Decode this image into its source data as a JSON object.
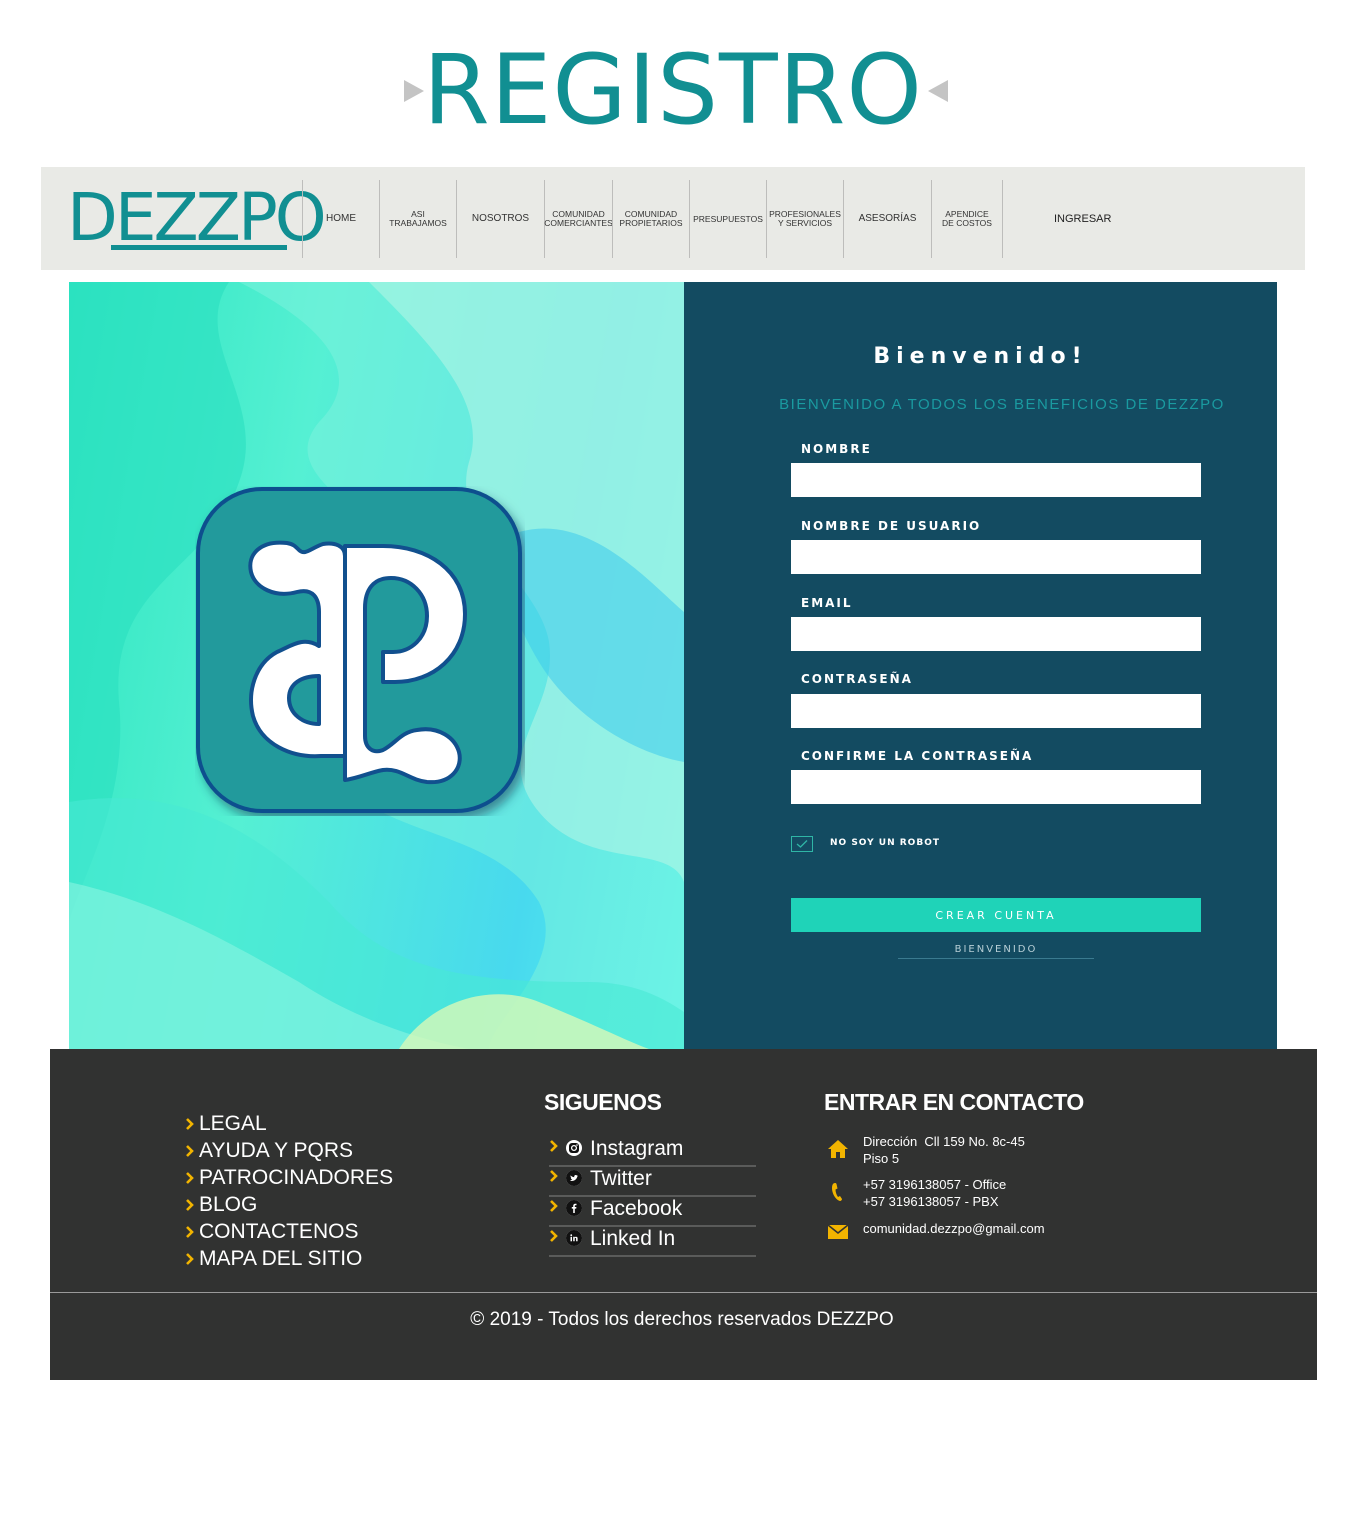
{
  "page": {
    "heading": "REGISTRO"
  },
  "nav": {
    "logo_text": "DEZZPO",
    "items": [
      {
        "label": "HOME"
      },
      {
        "label": "ASI\nTRABAJAMOS"
      },
      {
        "label": "NOSOTROS"
      },
      {
        "label": "COMUNIDAD\nCOMERCIANTES"
      },
      {
        "label": "COMUNIDAD\nPROPIETARIOS"
      },
      {
        "label": "PRESUPUESTOS"
      },
      {
        "label": "PROFESIONALES\nY SERVICIOS"
      },
      {
        "label": "ASESORÍAS"
      },
      {
        "label": "APENDICE\nDE COSTOS"
      }
    ],
    "login_label": "INGRESAR"
  },
  "form": {
    "title": "Bienvenido!",
    "subtitle": "BIENVENIDO A TODOS LOS BENEFICIOS DE DEZZPO",
    "fields": [
      {
        "label": "NOMBRE",
        "value": ""
      },
      {
        "label": "NOMBRE DE USUARIO",
        "value": ""
      },
      {
        "label": "EMAIL",
        "value": ""
      },
      {
        "label": "CONTRASEÑA",
        "value": ""
      },
      {
        "label": "CONFIRME LA CONTRASEÑA",
        "value": ""
      }
    ],
    "captcha_label": "NO SOY UN ROBOT",
    "captcha_checked": true,
    "submit_label": "CREAR CUENTA",
    "bottom_link": "BIENVENIDO"
  },
  "footer": {
    "links": [
      "LEGAL",
      "AYUDA Y PQRS",
      "PATROCINADORES",
      "BLOG",
      "CONTACTENOS",
      "MAPA DEL SITIO"
    ],
    "social_heading": "SIGUENOS",
    "social": [
      {
        "label": "Instagram",
        "icon": "instagram-icon"
      },
      {
        "label": "Twitter",
        "icon": "twitter-icon"
      },
      {
        "label": "Facebook",
        "icon": "facebook-icon"
      },
      {
        "label": "Linked In",
        "icon": "linkedin-icon"
      }
    ],
    "contact_heading": "ENTRAR EN CONTACTO",
    "address": "Dirección  Cll 159 No. 8c-45\nPiso 5",
    "phones": "+57 3196138057 - Office\n+57 3196138057 - PBX",
    "email": "comunidad.dezzpo@gmail.com",
    "copyright": "© 2019 - Todos los derechos reservados DEZZPO"
  },
  "colors": {
    "brand_teal": "#118f92",
    "panel_navy": "#134b61",
    "button_teal": "#1fd3b8",
    "footer_bg": "#313231",
    "accent_yellow": "#f2b400"
  }
}
